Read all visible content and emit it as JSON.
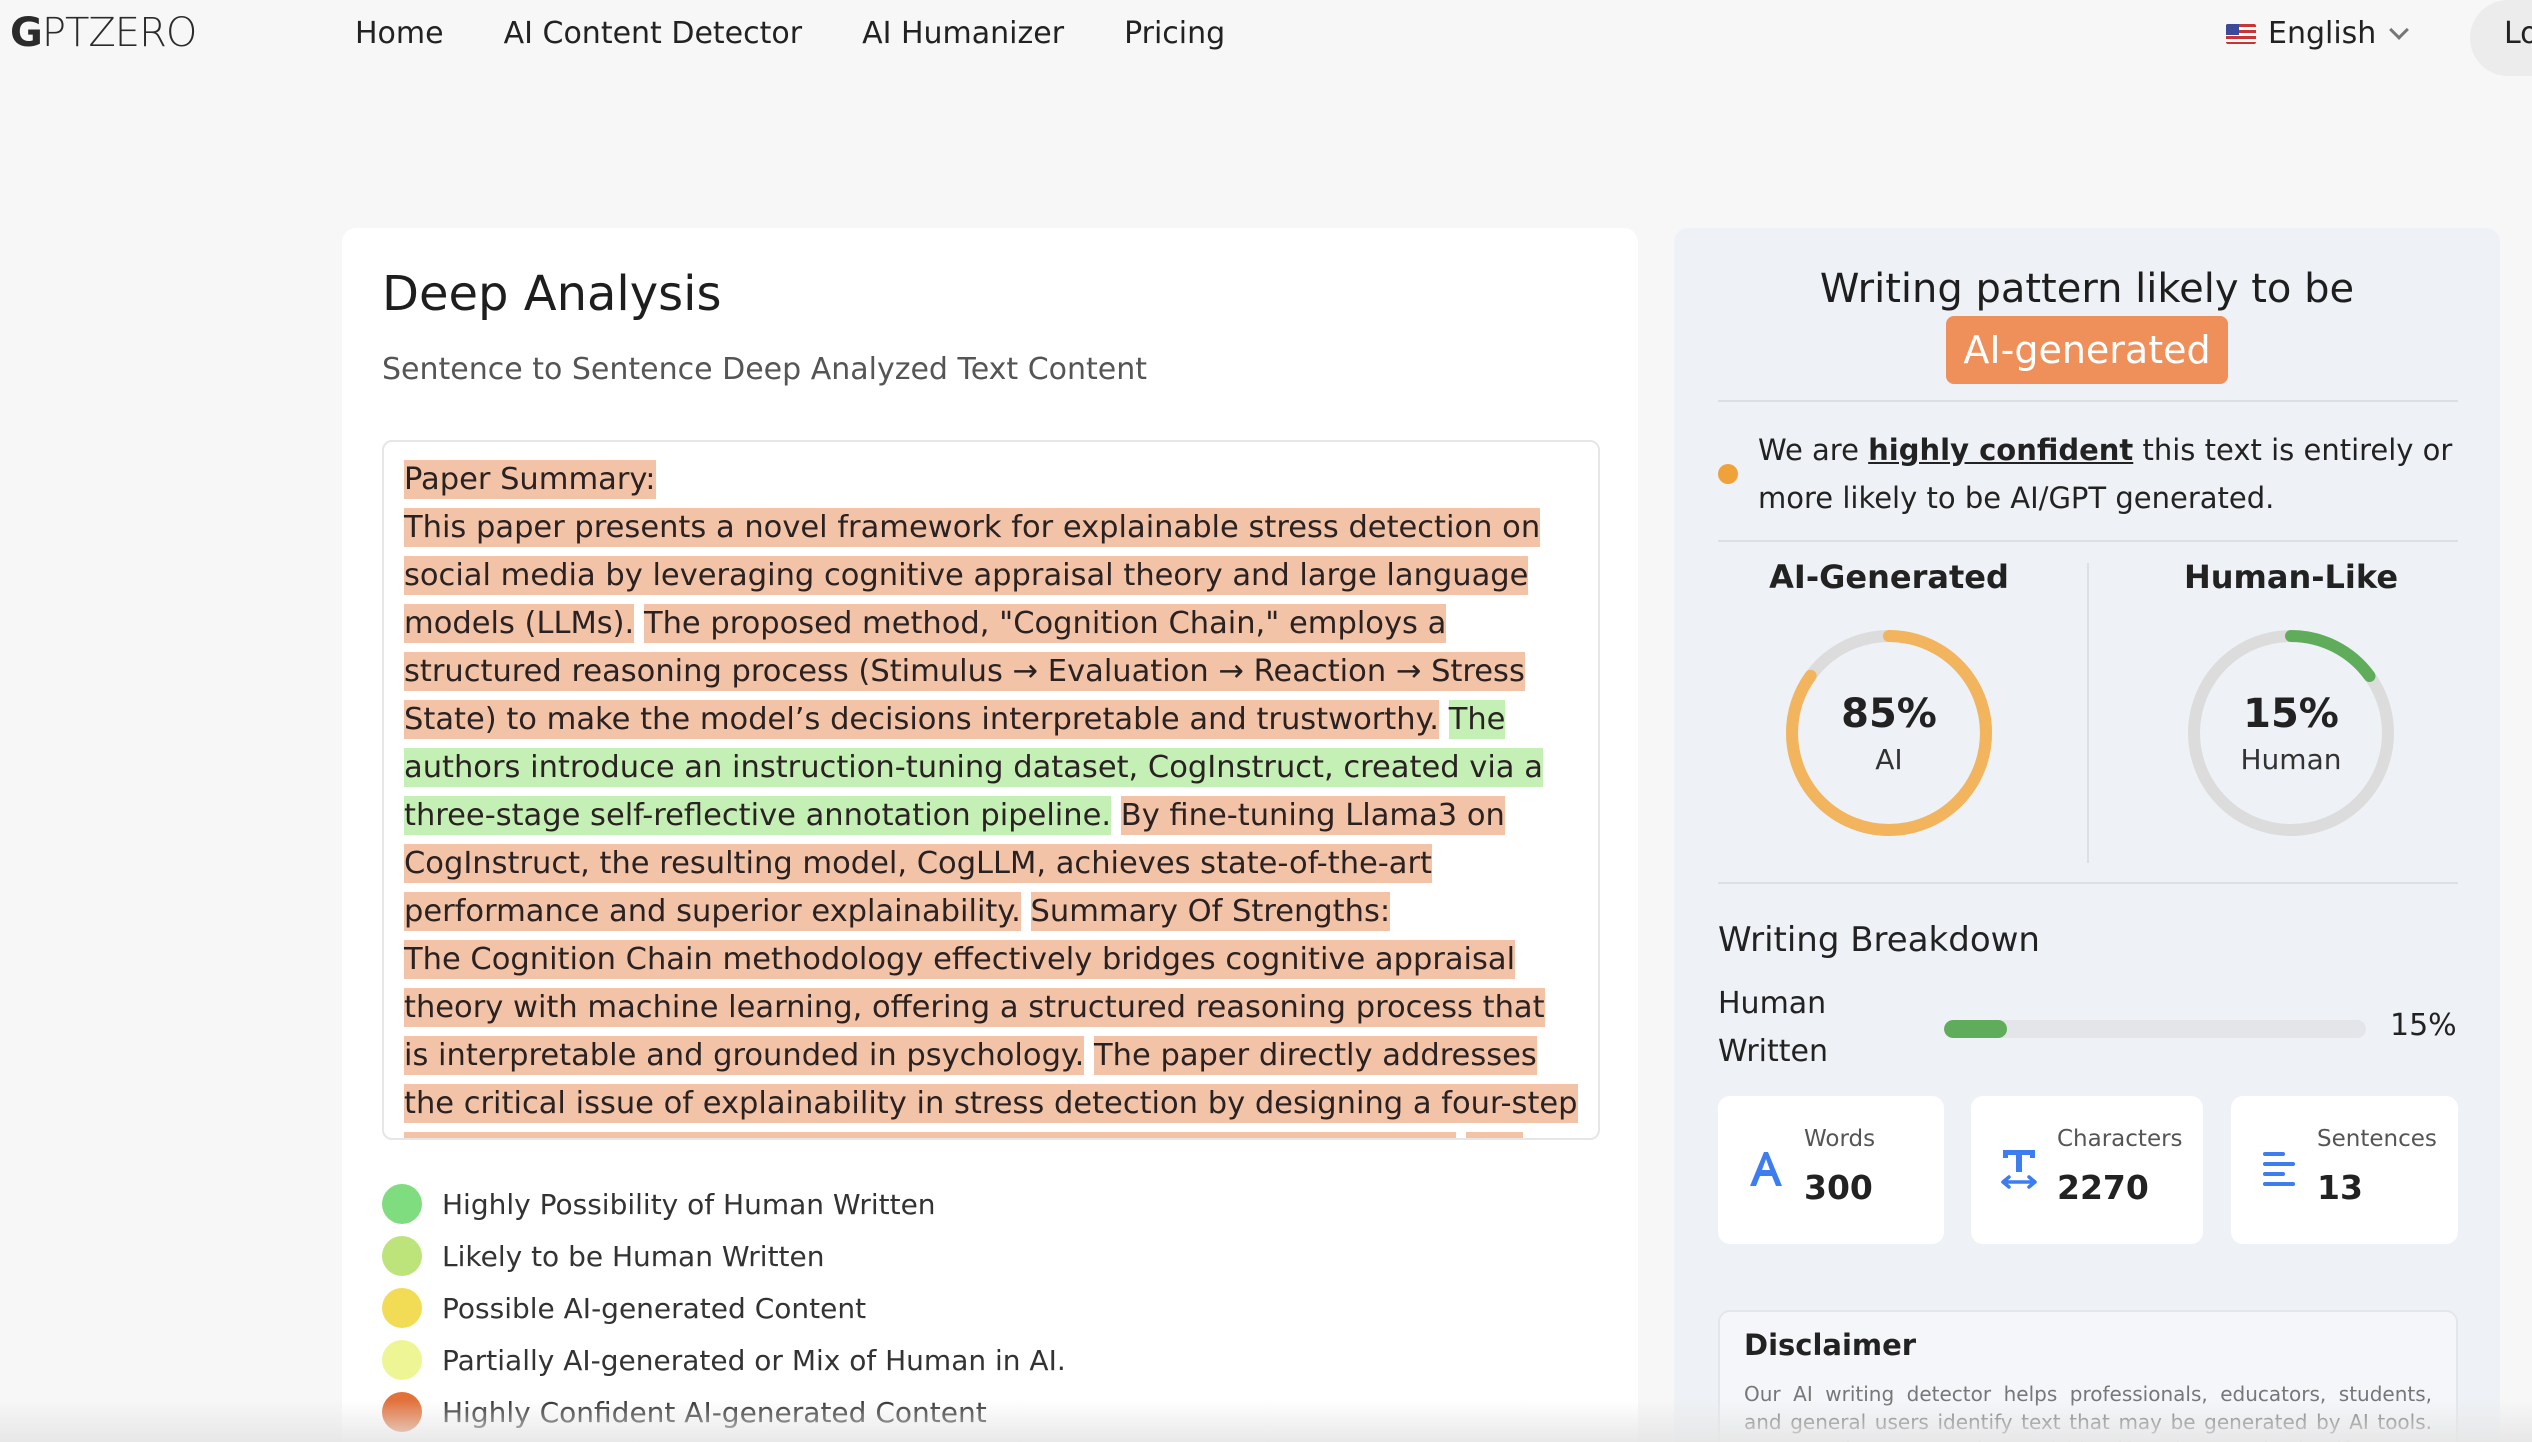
{
  "nav": {
    "logo": "GPTZERO",
    "links": [
      "Home",
      "AI Content Detector",
      "AI Humanizer",
      "Pricing"
    ],
    "language": "English",
    "login_label": "Lo"
  },
  "analysis": {
    "title": "Deep Analysis",
    "subtitle": "Sentence to Sentence Deep Analyzed Text Content",
    "segments": [
      {
        "text": "Paper Summary:",
        "class": "ai"
      },
      {
        "text": "This paper presents a novel framework for explainable stress detection on social media by leveraging cognitive appraisal theory and large language models (LLMs).",
        "class": "ai"
      },
      {
        "text": "The proposed method, \"Cognition Chain,\" employs a structured reasoning process (Stimulus → Evaluation → Reaction → Stress State) to make the model’s decisions interpretable and trustworthy.",
        "class": "ai"
      },
      {
        "text": "The authors introduce an instruction-tuning dataset, CogInstruct, created via a three-stage self-reflective annotation pipeline.",
        "class": "human"
      },
      {
        "text": "By fine-tuning Llama3 on CogInstruct, the resulting model, CogLLM, achieves state-of-the-art performance and superior explainability.",
        "class": "ai"
      },
      {
        "text": "Summary Of Strengths:",
        "class": "ai"
      },
      {
        "text": "The Cognition Chain methodology effectively bridges cognitive appraisal theory with machine learning, offering a structured reasoning process that is interpretable and grounded in psychology.",
        "class": "ai"
      },
      {
        "text": "The paper directly addresses the critical issue of explainability in stress detection by designing a four-step reasoning framework, which enhances trust and clinical applicability.",
        "class": "ai"
      },
      {
        "text": "The",
        "class": "ai"
      }
    ],
    "legend": [
      {
        "label": "Highly Possibility of Human Written",
        "color": "#7fdc7f"
      },
      {
        "label": "Likely to be Human Written",
        "color": "#bde47a"
      },
      {
        "label": "Possible AI-generated Content",
        "color": "#f2dc55"
      },
      {
        "label": "Partially AI-generated or Mix of Human in AI.",
        "color": "#eef594"
      },
      {
        "label": "Highly Confident AI-generated Content",
        "color": "#e2713a"
      }
    ]
  },
  "result": {
    "title": "Writing pattern likely to be",
    "badge": "AI-generated",
    "confidence_prefix": "We are ",
    "confidence_emphasis": "highly confident",
    "confidence_suffix": " this text is entirely or more likely to be AI/GPT generated.",
    "ai": {
      "label": "AI-Generated",
      "percent": 85,
      "percent_text": "85%",
      "sub": "AI",
      "color": "#f2b45c"
    },
    "human": {
      "label": "Human-Like",
      "percent": 15,
      "percent_text": "15%",
      "sub": "Human",
      "color": "#5fad5a"
    },
    "breakdown": {
      "title": "Writing Breakdown",
      "row_label": "Human Written",
      "percent": 15,
      "percent_text": "15%"
    },
    "stats": [
      {
        "label": "Words",
        "value": "300",
        "icon": "font-a-icon"
      },
      {
        "label": "Characters",
        "value": "2270",
        "icon": "text-width-icon"
      },
      {
        "label": "Sentences",
        "value": "13",
        "icon": "align-left-icon"
      }
    ],
    "disclaimer": {
      "title": "Disclaimer",
      "text": "Our AI writing detector helps professionals, educators, students, and general users identify text that may be generated by AI tools. However, it may sometimes misidentify or incorrectly classify AI"
    }
  }
}
